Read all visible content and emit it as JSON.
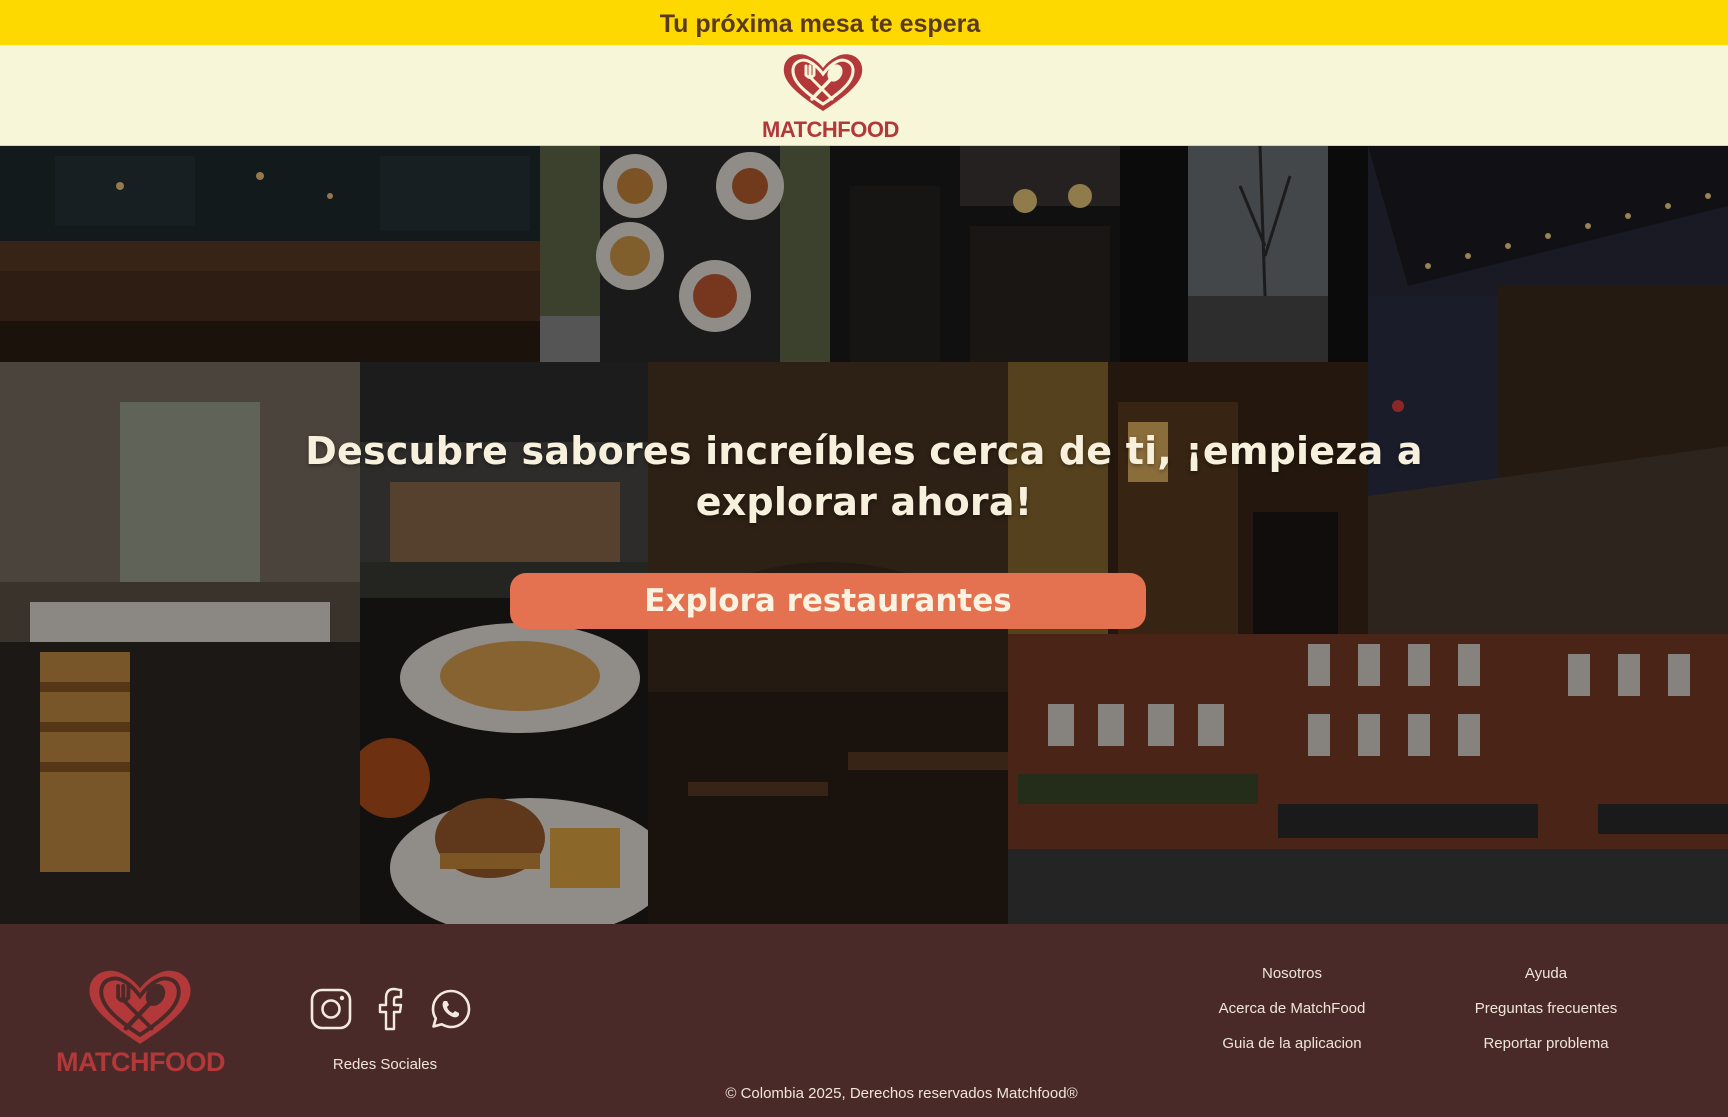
{
  "banner": {
    "text": "Tu próxima mesa te espera"
  },
  "brand": {
    "name": "MATCHFOOD",
    "color": "#b2383a"
  },
  "hero": {
    "title": "Descubre sabores increíbles cerca de ti, ¡empieza a explorar ahora!",
    "button_label": "Explora restaurantes",
    "button_color": "#e4714f"
  },
  "footer": {
    "social_label": "Redes Sociales",
    "social_icons": [
      "instagram-icon",
      "facebook-icon",
      "whatsapp-icon"
    ],
    "columns": [
      {
        "title": "Nosotros",
        "links": [
          "Acerca de MatchFood",
          "Guia de la aplicacion"
        ]
      },
      {
        "title": "Ayuda",
        "links": [
          "Preguntas frecuentes",
          "Reportar problema"
        ]
      }
    ],
    "copyright": "© Colombia 2025, Derechos reservados Matchfood®"
  },
  "colors": {
    "banner": "#fdd900",
    "header": "#f7f6d8",
    "footer": "#4a2a28"
  }
}
